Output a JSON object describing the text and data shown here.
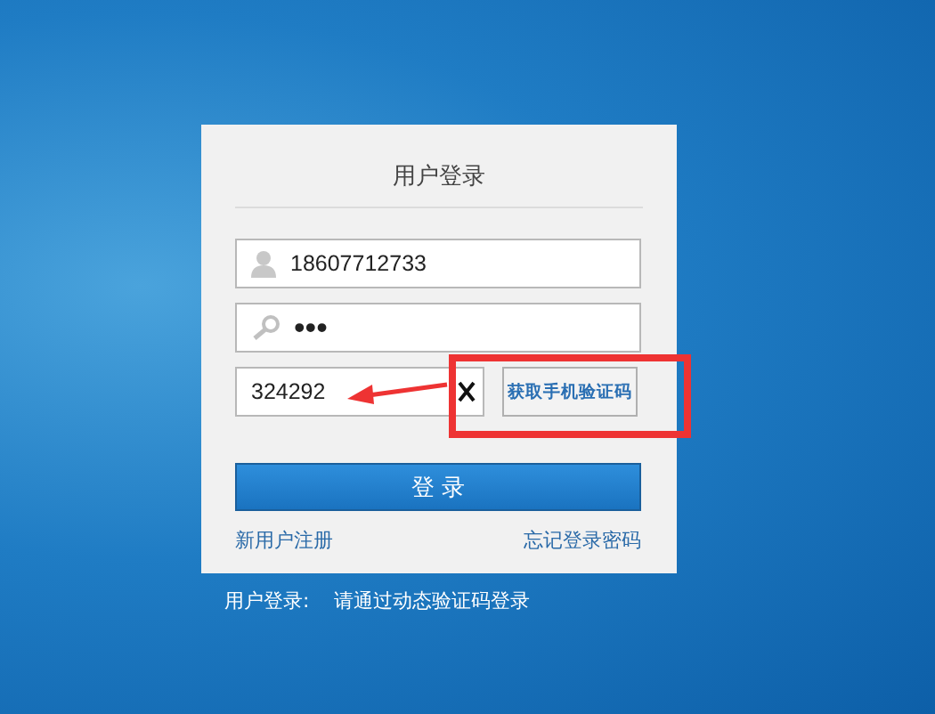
{
  "login_panel": {
    "title": "用户登录",
    "username": {
      "value": "18607712733"
    },
    "password": {
      "value": "•••"
    },
    "code": {
      "value": "324292"
    },
    "get_code_button": "获取手机验证码",
    "login_button": "登 录",
    "register_link": "新用户注册",
    "forgot_link": "忘记登录密码"
  },
  "footer": {
    "label": "用户登录:",
    "message": "请通过动态验证码登录"
  }
}
